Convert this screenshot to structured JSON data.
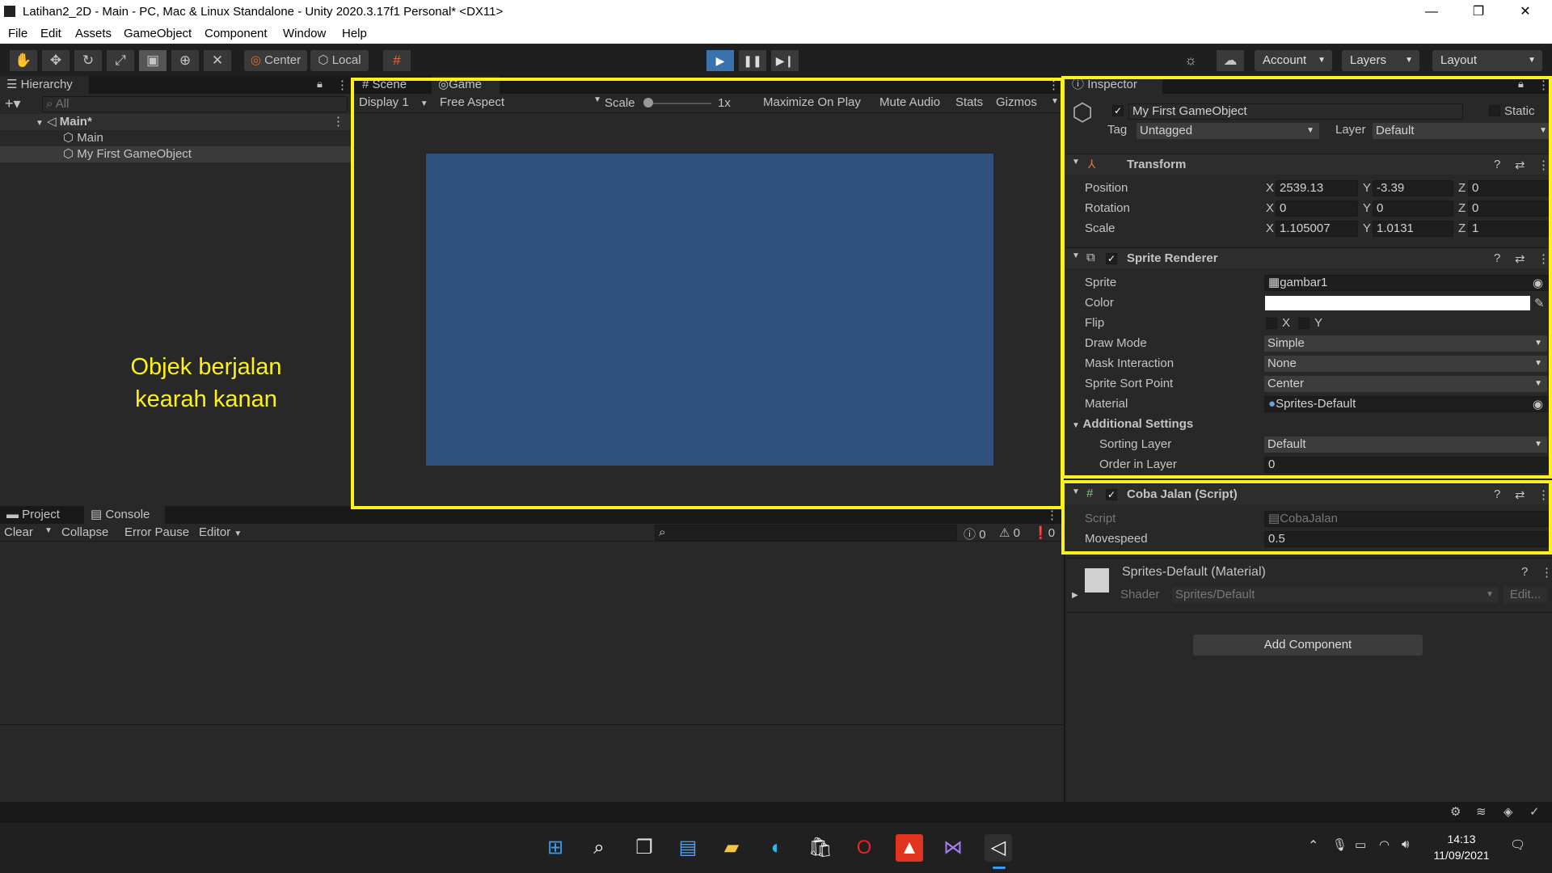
{
  "window": {
    "title": "Latihan2_2D - Main - PC, Mac & Linux Standalone - Unity 2020.3.17f1 Personal* <DX11>",
    "minimize": "—",
    "maximize": "❐",
    "close": "✕"
  },
  "menu": [
    "File",
    "Edit",
    "Assets",
    "GameObject",
    "Component",
    "Window",
    "Help"
  ],
  "toolbar": {
    "pivot": "Center",
    "space": "Local",
    "account": "Account",
    "layers": "Layers",
    "layout": "Layout"
  },
  "hierarchy": {
    "tab": "Hierarchy",
    "search_placeholder": "All",
    "scene": "Main*",
    "items": [
      "Main",
      "My First GameObject"
    ]
  },
  "scene_view": {
    "tab_scene": "Scene",
    "tab_game": "Game",
    "display": "Display 1",
    "aspect": "Free Aspect",
    "scale_label": "Scale",
    "scale_value": "1x",
    "maximize": "Maximize On Play",
    "mute": "Mute Audio",
    "stats": "Stats",
    "gizmos": "Gizmos",
    "game_bg": "#30507d"
  },
  "annotation": {
    "line1": "Objek berjalan",
    "line2": "kearah kanan"
  },
  "console": {
    "tab_project": "Project",
    "tab_console": "Console",
    "clear": "Clear",
    "collapse": "Collapse",
    "error_pause": "Error Pause",
    "editor": "Editor",
    "count_log": "0",
    "count_warn": "0",
    "count_err": "0"
  },
  "inspector": {
    "tab": "Inspector",
    "object_name": "My First GameObject",
    "static": "Static",
    "tag_label": "Tag",
    "tag": "Untagged",
    "layer_label": "Layer",
    "layer": "Default",
    "transform": {
      "title": "Transform",
      "position": {
        "label": "Position",
        "x": "2539.13",
        "y": "-3.39",
        "z": "0"
      },
      "rotation": {
        "label": "Rotation",
        "x": "0",
        "y": "0",
        "z": "0"
      },
      "scale": {
        "label": "Scale",
        "x": "1.105007",
        "y": "1.0131",
        "z": "1"
      }
    },
    "sprite_renderer": {
      "title": "Sprite Renderer",
      "sprite_label": "Sprite",
      "sprite": "gambar1",
      "color_label": "Color",
      "flip_label": "Flip",
      "flip_x": "X",
      "flip_y": "Y",
      "draw_mode_label": "Draw Mode",
      "draw_mode": "Simple",
      "mask_label": "Mask Interaction",
      "mask": "None",
      "sort_point_label": "Sprite Sort Point",
      "sort_point": "Center",
      "material_label": "Material",
      "material": "Sprites-Default",
      "additional": "Additional Settings",
      "sorting_layer_label": "Sorting Layer",
      "sorting_layer": "Default",
      "order_label": "Order in Layer",
      "order": "0"
    },
    "script": {
      "title": "Coba Jalan (Script)",
      "script_label": "Script",
      "script": "CobaJalan",
      "movespeed_label": "Movespeed",
      "movespeed": "0.5"
    },
    "material": {
      "title": "Sprites-Default (Material)",
      "shader_label": "Shader",
      "shader": "Sprites/Default",
      "edit": "Edit..."
    },
    "add_component": "Add Component"
  },
  "taskbar": {
    "time": "14:13",
    "date": "11/09/2021"
  },
  "colors": {
    "highlight": "#fbf21b",
    "accent": "#3a72b0"
  }
}
